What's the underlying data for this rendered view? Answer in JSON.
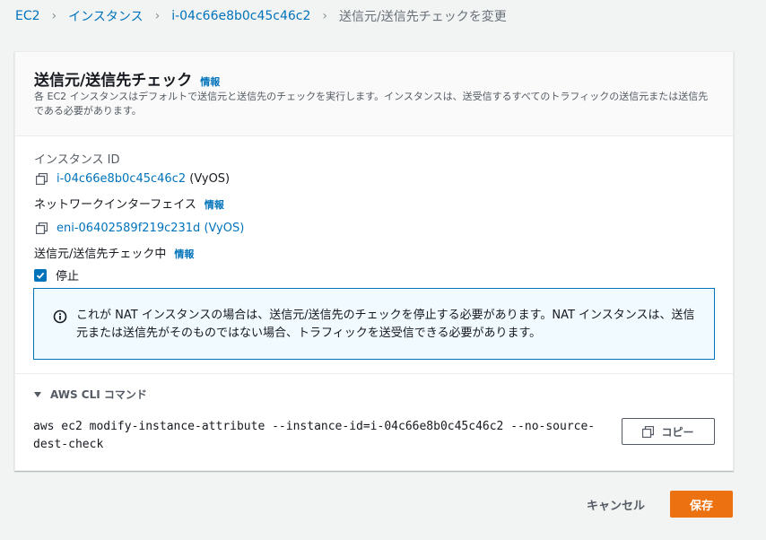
{
  "breadcrumb": {
    "items": [
      "EC2",
      "インスタンス",
      "i-04c66e8b0c45c46c2"
    ],
    "current": "送信元/送信先チェックを変更"
  },
  "panel": {
    "title": "送信元/送信先チェック",
    "info": "情報",
    "description": "各 EC2 インスタンスはデフォルトで送信元と送信先のチェックを実行します。インスタンスは、送受信するすべてのトラフィックの送信元または送信先である必要があります。"
  },
  "instance": {
    "label": "インスタンス ID",
    "id": "i-04c66e8b0c45c46c2",
    "name": "(VyOS)"
  },
  "network_interface": {
    "label": "ネットワークインターフェイス",
    "info": "情報",
    "value": "eni-06402589f219c231d (VyOS)"
  },
  "check": {
    "label": "送信元/送信先チェック中",
    "info": "情報",
    "checkbox_label": "停止",
    "checked": true
  },
  "alert": {
    "text": "これが NAT インスタンスの場合は、送信元/送信先のチェックを停止する必要があります。NAT インスタンスは、送信元または送信先がそのものではない場合、トラフィックを送受信できる必要があります。"
  },
  "cli": {
    "toggle_label": "AWS CLI コマンド",
    "command": "aws ec2 modify-instance-attribute --instance-id=i-04c66e8b0c45c46c2 --no-source-dest-check",
    "copy_label": "コピー"
  },
  "actions": {
    "cancel": "キャンセル",
    "save": "保存"
  },
  "colors": {
    "link": "#0073bb",
    "primary": "#ec7211",
    "alert_bg": "#f1faff"
  }
}
